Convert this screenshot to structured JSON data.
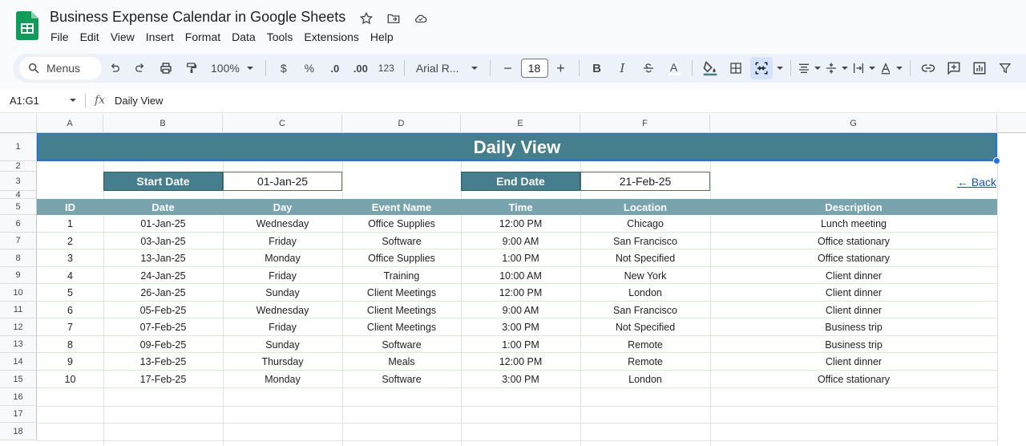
{
  "app": {
    "title": "Business Expense Calendar in Google Sheets",
    "menus": [
      "File",
      "Edit",
      "View",
      "Insert",
      "Format",
      "Data",
      "Tools",
      "Extensions",
      "Help"
    ]
  },
  "toolbar": {
    "search_label": "Menus",
    "zoom": "100%",
    "currency": "$",
    "percent": "%",
    "dec_decrease": ".0",
    "dec_increase": ".00",
    "number_format": "123",
    "font": "Arial R...",
    "font_size": "18",
    "minus": "−",
    "plus": "+",
    "bold": "B",
    "italic": "I",
    "text_color": "A"
  },
  "formula_bar": {
    "name_box": "A1:G1",
    "fx": "fx",
    "content": "Daily View"
  },
  "columns": [
    "A",
    "B",
    "C",
    "D",
    "E",
    "F",
    "G"
  ],
  "rows": [
    "1",
    "2",
    "3",
    "4",
    "5",
    "6",
    "7",
    "8",
    "9",
    "10",
    "11",
    "12",
    "13",
    "14",
    "15",
    "16",
    "17",
    "18"
  ],
  "sheet": {
    "title": "Daily View",
    "start_label": "Start Date",
    "start_value": "01-Jan-25",
    "end_label": "End Date",
    "end_value": "21-Feb-25",
    "back_link": "← Back",
    "headers": [
      "ID",
      "Date",
      "Day",
      "Event Name",
      "Time",
      "Location",
      "Description"
    ],
    "data": [
      [
        "1",
        "01-Jan-25",
        "Wednesday",
        "Office Supplies",
        "12:00 PM",
        "Chicago",
        "Lunch meeting"
      ],
      [
        "2",
        "03-Jan-25",
        "Friday",
        "Software",
        "9:00 AM",
        "San Francisco",
        "Office stationary"
      ],
      [
        "3",
        "13-Jan-25",
        "Monday",
        "Office Supplies",
        "1:00 PM",
        "Not Specified",
        "Office stationary"
      ],
      [
        "4",
        "24-Jan-25",
        "Friday",
        "Training",
        "10:00 AM",
        "New York",
        "Client dinner"
      ],
      [
        "5",
        "26-Jan-25",
        "Sunday",
        "Client Meetings",
        "12:00 PM",
        "London",
        "Client dinner"
      ],
      [
        "6",
        "05-Feb-25",
        "Wednesday",
        "Client Meetings",
        "9:00 AM",
        "San Francisco",
        "Client dinner"
      ],
      [
        "7",
        "07-Feb-25",
        "Friday",
        "Client Meetings",
        "3:00 PM",
        "Not Specified",
        "Business trip"
      ],
      [
        "8",
        "09-Feb-25",
        "Sunday",
        "Software",
        "1:00 PM",
        "Remote",
        "Business trip"
      ],
      [
        "9",
        "13-Feb-25",
        "Thursday",
        "Meals",
        "12:00 PM",
        "Remote",
        "Client dinner"
      ],
      [
        "10",
        "17-Feb-25",
        "Monday",
        "Software",
        "3:00 PM",
        "London",
        "Office stationary"
      ]
    ]
  },
  "colors": {
    "header_teal": "#457e8c",
    "table_header": "#77a4ad",
    "selection": "#1a73e8",
    "link": "#1155cc"
  }
}
